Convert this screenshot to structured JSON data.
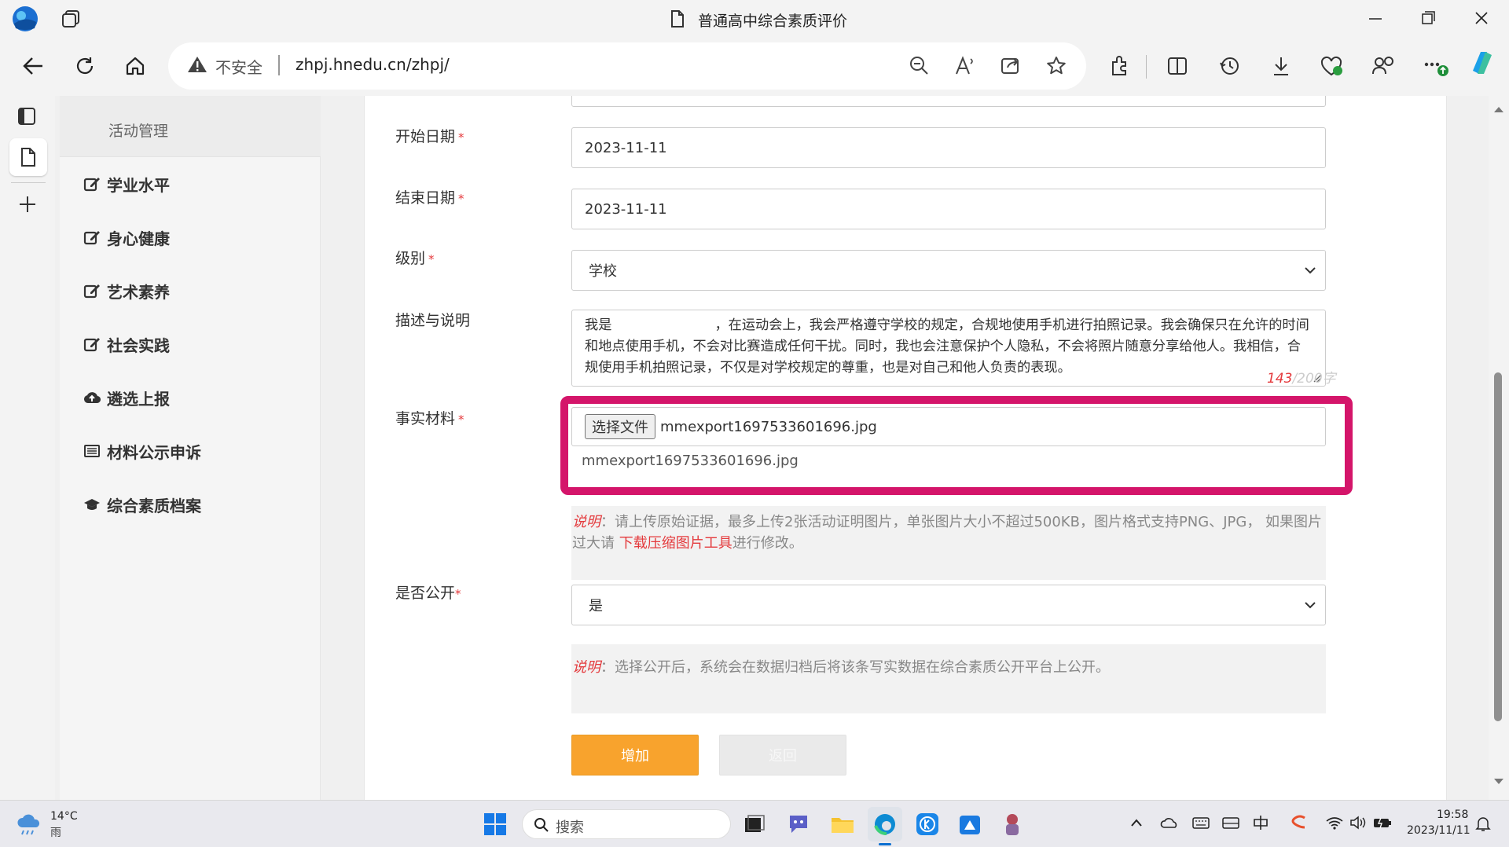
{
  "window": {
    "title": "普通高中综合素质评价"
  },
  "address": {
    "security_label": "不安全",
    "url": "zhpj.hnedu.cn/zhpj/"
  },
  "sidebar": {
    "title": "活动管理",
    "items": [
      {
        "label": "学业水平",
        "icon": "edit-icon"
      },
      {
        "label": "身心健康",
        "icon": "edit-icon"
      },
      {
        "label": "艺术素养",
        "icon": "edit-icon"
      },
      {
        "label": "社会实践",
        "icon": "edit-icon"
      },
      {
        "label": "遴选上报",
        "icon": "cloud-upload-icon"
      },
      {
        "label": "材料公示申诉",
        "icon": "list-icon"
      },
      {
        "label": "综合素质档案",
        "icon": "graduation-cap-icon"
      }
    ]
  },
  "form": {
    "start_date": {
      "label": "开始日期",
      "value": "2023-11-11"
    },
    "end_date": {
      "label": "结束日期",
      "value": "2023-11-11"
    },
    "level": {
      "label": "级别",
      "value": "学校"
    },
    "description": {
      "label": "描述与说明",
      "value": "我是                        ，在运动会上，我会严格遵守学校的规定，合规地使用手机进行拍照记录。我会确保只在允许的时间和地点使用手机，不会对比赛造成任何干扰。同时，我也会注意保护个人隐私，不会将照片随意分享给他人。我相信，合规使用手机拍照记录，不仅是对学校规定的尊重，也是对自己和他人负责的表现。",
      "count": "143",
      "max": "/200字"
    },
    "evidence": {
      "label": "事实材料",
      "choose_button": "选择文件",
      "file_name": "mmexport1697533601696.jpg",
      "uploaded_file": "mmexport1697533601696.jpg"
    },
    "evidence_note": {
      "prefix": "说明",
      "text": "：请上传原始证据，最多上传2张活动证明图片，单张图片大小不超过500KB，图片格式支持PNG、JPG， 如果图片过大请 ",
      "link": "下载压缩图片工具",
      "suffix": "进行修改。"
    },
    "public": {
      "label": "是否公开",
      "value": "是"
    },
    "public_note": {
      "prefix": "说明",
      "text": "：选择公开后，系统会在数据归档后将该条写实数据在综合素质公开平台上公开。"
    },
    "required_mark": "*",
    "add_button": "增加",
    "back_button": "返回"
  },
  "taskbar": {
    "weather_temp": "14°C",
    "weather_desc": "雨",
    "search_placeholder": "搜索",
    "time": "19:58",
    "date": "2023/11/11"
  },
  "colors": {
    "accent_orange": "#f8a32d",
    "highlight": "#d4156a",
    "required_red": "#e4393c"
  }
}
